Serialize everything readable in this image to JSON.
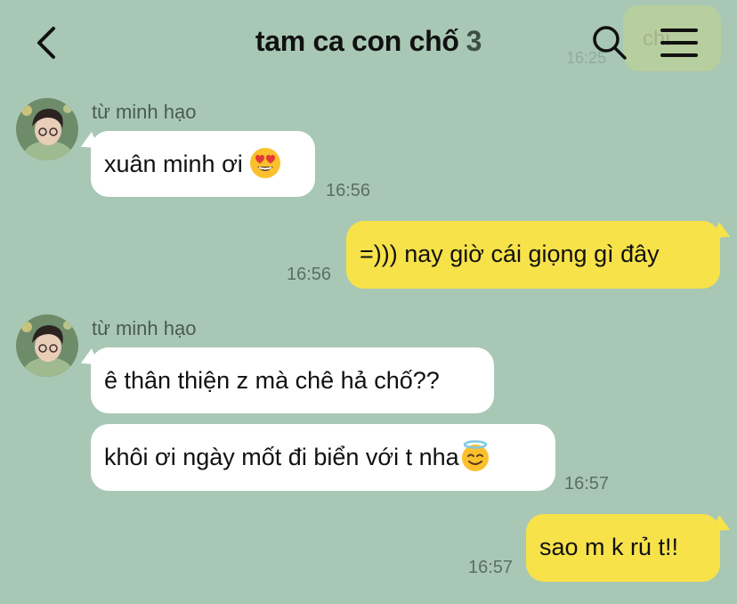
{
  "header": {
    "title": "tam ca con chố",
    "member_count": "3",
    "ghost_text": "chi",
    "ghost_time": "16:25"
  },
  "icons": {
    "back": "chevron-left-icon",
    "search": "search-icon",
    "menu": "hamburger-menu-icon"
  },
  "colors": {
    "background": "#a8c8b5",
    "incoming_bubble": "#ffffff",
    "outgoing_bubble": "#f7e24a"
  },
  "messages": [
    {
      "direction": "in",
      "sender": "từ minh hạo",
      "text": "xuân minh ơi ",
      "emoji": "heart-eyes-emoji",
      "time": "16:56"
    },
    {
      "direction": "out",
      "text": "=))) nay giờ cái giọng gì đây",
      "time": "16:56"
    },
    {
      "direction": "in",
      "sender": "từ minh hạo",
      "text": "ê thân thiện z mà chê hả chố??"
    },
    {
      "direction": "in",
      "text": "khôi ơi ngày mốt đi biển với t nha",
      "emoji": "smiling-face-with-halo-emoji",
      "time": "16:57"
    },
    {
      "direction": "out",
      "text": "sao m k rủ t!!",
      "time": "16:57"
    }
  ]
}
